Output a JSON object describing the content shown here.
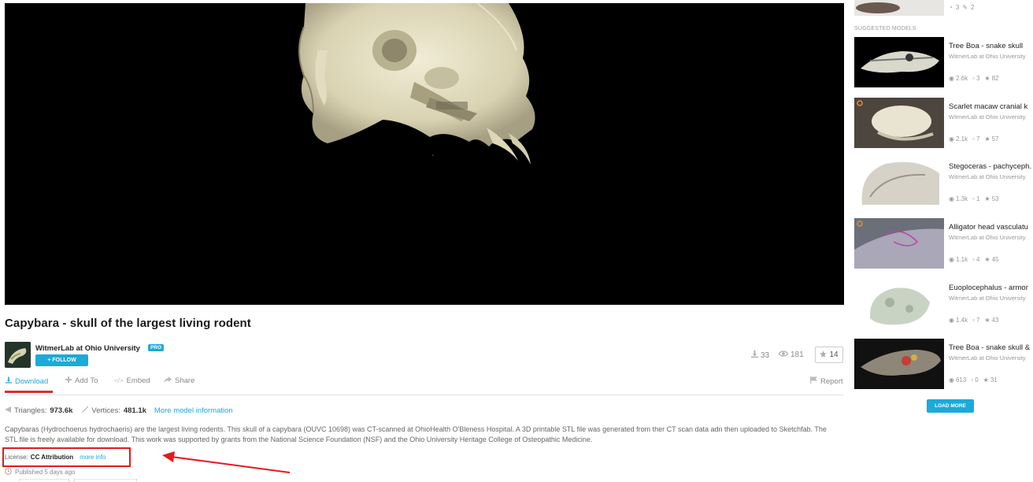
{
  "model": {
    "title": "Capybara - skull of the largest living rodent",
    "author": "WitmerLab at Ohio University",
    "pro_badge": "PRO",
    "follow_label": "+ FOLLOW",
    "downloads": "33",
    "views": "181",
    "likes": "14"
  },
  "actions": {
    "download": "Download",
    "add_to": "Add To",
    "embed": "Embed",
    "share": "Share",
    "report": "Report"
  },
  "info": {
    "triangles_label": "Triangles:",
    "triangles_value": "973.6k",
    "vertices_label": "Vertices:",
    "vertices_value": "481.1k",
    "more_info": "More model information"
  },
  "description": "Capybaras (Hydrochoerus hydrochaeris) are the largest living rodents. This skull of a capybara (OUVC 10698) was CT-scanned at OhioHealth O'Bleness Hospital. A 3D printable STL file was generated from ther CT scan data adn then uploaded to Sketchfab. The STL file is freely available for download. This work was supported by grants from the National Science Foundation (NSF) and the Ohio University Heritage College of Osteopathic Medicine.",
  "license": {
    "label": "License:",
    "value": "CC Attribution",
    "more_info": "more info"
  },
  "published": "Published 5 days ago",
  "sidebar": {
    "top_item_stats": {
      "likes": "3",
      "comments": "2"
    },
    "heading": "SUGGESTED MODELS",
    "items": [
      {
        "title": "Tree Boa - snake skull",
        "author": "WitmerLab at Ohio University",
        "views": "2.6k",
        "comments": "3",
        "likes": "82"
      },
      {
        "title": "Scarlet macaw cranial k",
        "author": "WitmerLab at Ohio University",
        "views": "2.1k",
        "comments": "7",
        "likes": "57"
      },
      {
        "title": "Stegoceras - pachyceph.",
        "author": "WitmerLab at Ohio University",
        "views": "1.3k",
        "comments": "1",
        "likes": "53"
      },
      {
        "title": "Alligator head vasculatu",
        "author": "WitmerLab at Ohio University",
        "views": "1.1k",
        "comments": "4",
        "likes": "45"
      },
      {
        "title": "Euoplocephalus - armor",
        "author": "WitmerLab at Ohio University",
        "views": "1.4k",
        "comments": "7",
        "likes": "43"
      },
      {
        "title": "Tree Boa - snake skull &",
        "author": "WitmerLab at Ohio University",
        "views": "613",
        "comments": "0",
        "likes": "31"
      }
    ],
    "load_more": "LOAD MORE"
  },
  "colors": {
    "accent": "#1caad9",
    "annotation_red": "#e21b1b",
    "viewer_bg": "#000000",
    "bone": "#e6e0c4"
  }
}
